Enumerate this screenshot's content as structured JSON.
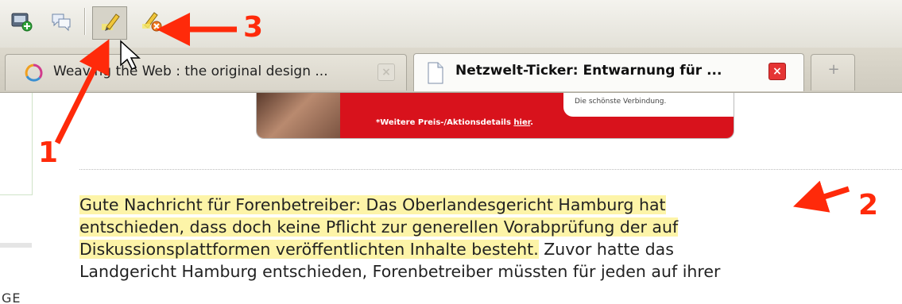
{
  "toolbar": {
    "icons": [
      "new-comment-icon",
      "comments-icon",
      "highlighter-icon",
      "erase-highlight-icon"
    ],
    "pressed": "highlighter-icon"
  },
  "tabs": [
    {
      "title": "Weaving the Web : the original design ...",
      "active": false
    },
    {
      "title": "Netzwelt-Ticker: Entwarnung für ...",
      "active": true
    },
    {
      "title": "+",
      "active": false
    }
  ],
  "ad": {
    "tagline": "Die schönste Verbindung.",
    "details_prefix": "*Weitere Preis-/Aktionsdetails ",
    "details_link": "hier",
    "details_suffix": "."
  },
  "article": {
    "highlighted": [
      "Gute Nachricht für Forenbetreiber: Das Oberlandesgericht Hamburg hat",
      "entschieden, dass doch keine Pflicht zur generellen Vorabprüfung der auf",
      "Diskussionsplattformen veröffentlichten Inhalte besteht."
    ],
    "rest_line3": " Zuvor hatte das",
    "line4": "Landgericht Hamburg entschieden, Forenbetreiber müssten für jeden auf ihrer"
  },
  "sidebar": {
    "fragment": "GE"
  },
  "annotations": {
    "one": "1",
    "two": "2",
    "three": "3"
  },
  "colors": {
    "highlight": "#fdf4a8",
    "annotation": "#ff2a0a",
    "ad_red": "#d8121c"
  }
}
